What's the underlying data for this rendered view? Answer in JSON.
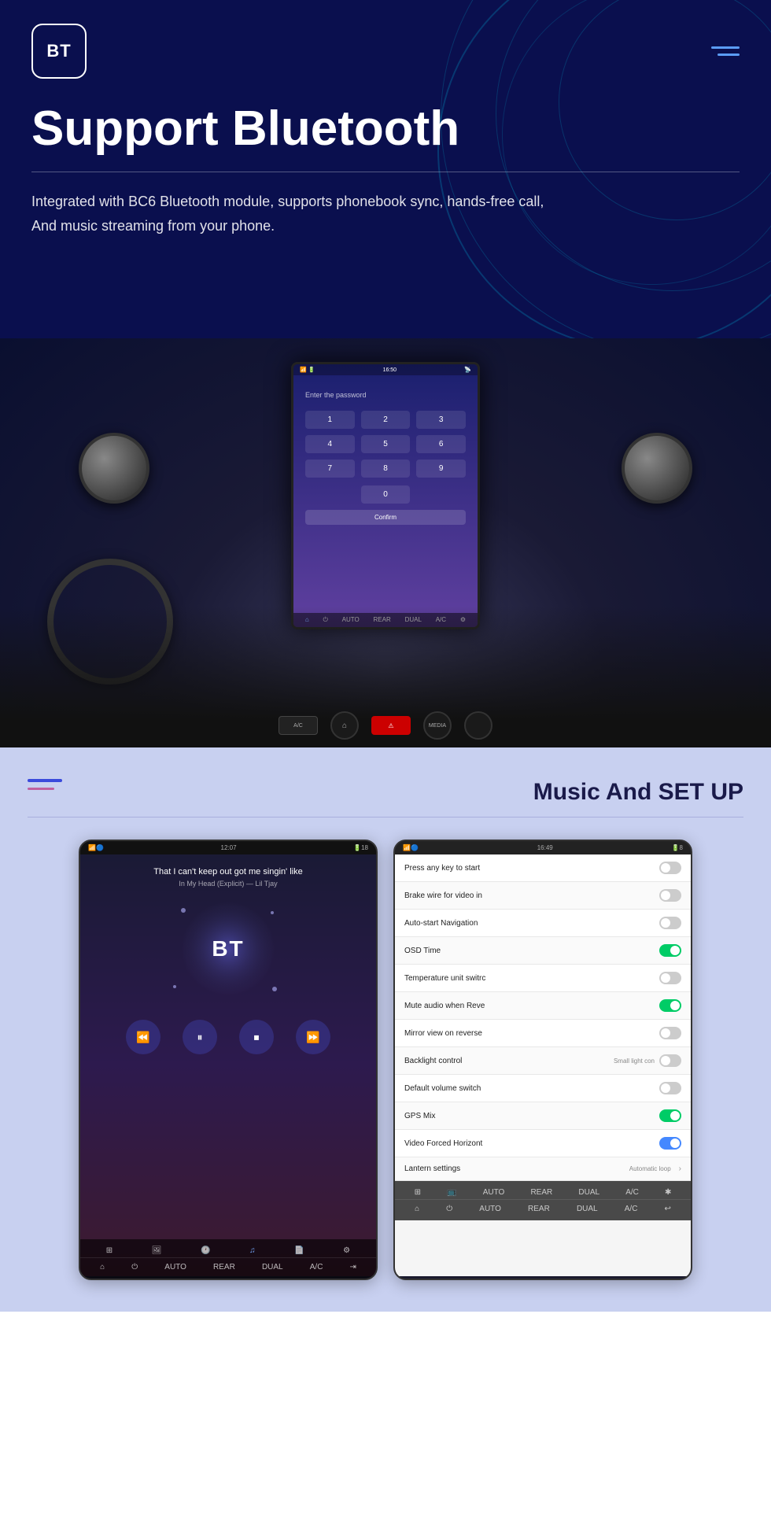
{
  "header": {
    "logo_text": "BT",
    "title": "Support Bluetooth",
    "description_line1": "Integrated with BC6 Bluetooth module, supports phonebook sync, hands-free call,",
    "description_line2": "And music streaming from your phone.",
    "divider": true
  },
  "screen": {
    "time": "16:50",
    "password_label": "Enter the password",
    "numpad": [
      "1",
      "2",
      "3",
      "4",
      "5",
      "6",
      "7",
      "8",
      "9",
      "0"
    ],
    "confirm_btn": "Confirm"
  },
  "music_section": {
    "title": "Music And SET UP",
    "phone_left": {
      "status_time": "12:07",
      "status_battery": "18",
      "song_title": "That I can't keep out got me singin' like",
      "song_artist": "In My Head (Explicit) — Lil Tjay",
      "album_text": "BT",
      "controls": [
        "⏮",
        "⏭",
        "⏹",
        "⏭"
      ]
    },
    "phone_right": {
      "status_time": "16:49",
      "status_battery": "8",
      "settings": [
        {
          "label": "Press any key to start",
          "toggle": "off",
          "extra": ""
        },
        {
          "label": "Brake wire for video in",
          "toggle": "off",
          "extra": ""
        },
        {
          "label": "Auto-start Navigation",
          "toggle": "off",
          "extra": ""
        },
        {
          "label": "OSD Time",
          "toggle": "green-on",
          "extra": ""
        },
        {
          "label": "Temperature unit switrc",
          "toggle": "off",
          "extra": ""
        },
        {
          "label": "Mute audio when Reve",
          "toggle": "green-on",
          "extra": ""
        },
        {
          "label": "Mirror view on reverse",
          "toggle": "off",
          "extra": ""
        },
        {
          "label": "Backlight control",
          "toggle": "off",
          "extra": "Small light con"
        },
        {
          "label": "Default volume switch",
          "toggle": "off",
          "extra": ""
        },
        {
          "label": "GPS Mix",
          "toggle": "green-on",
          "extra": ""
        },
        {
          "label": "Video Forced Horizont",
          "toggle": "blue-on",
          "extra": ""
        },
        {
          "label": "Lantern settings",
          "toggle": "chevron",
          "extra": "Automatic loop"
        }
      ]
    }
  },
  "icons": {
    "hamburger": "≡",
    "music_hamburger_line1": "",
    "music_hamburger_line2": "",
    "prev": "⏮",
    "play": "▶",
    "stop": "⏹",
    "next": "⏭",
    "rewind": "⏪",
    "forward": "⏩"
  }
}
